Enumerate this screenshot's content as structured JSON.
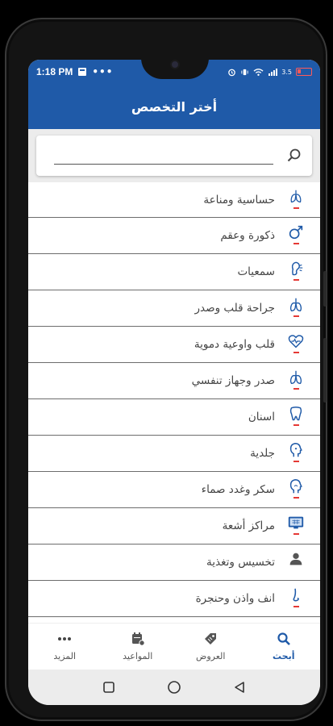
{
  "status_bar": {
    "time": "1:18 PM",
    "dots": "•••",
    "net_speed": "3.5"
  },
  "app_bar": {
    "title": "أختر التخصص"
  },
  "search": {
    "value": "",
    "placeholder": ""
  },
  "specialties": [
    {
      "label": "حساسية ومناعة",
      "icon": "lungs-outline-icon"
    },
    {
      "label": "ذكورة وعقم",
      "icon": "male-symbol-icon"
    },
    {
      "label": "سمعيات",
      "icon": "ear-icon"
    },
    {
      "label": "جراحة قلب وصدر",
      "icon": "lungs-icon"
    },
    {
      "label": "قلب واوعية دموية",
      "icon": "heart-pulse-icon"
    },
    {
      "label": "صدر وجهاز تنفسي",
      "icon": "lungs-icon"
    },
    {
      "label": "اسنان",
      "icon": "tooth-icon"
    },
    {
      "label": "جلدية",
      "icon": "head-profile-icon"
    },
    {
      "label": "سكر وغدد صماء",
      "icon": "head-profile-icon"
    },
    {
      "label": "مراكز أشعة",
      "icon": "monitor-icon"
    },
    {
      "label": "تخسيس وتغذية",
      "icon": "person-icon"
    },
    {
      "label": "انف واذن وحنجرة",
      "icon": "nose-icon"
    }
  ],
  "bottom_nav": [
    {
      "label": "أبحث",
      "icon": "search-icon",
      "active": true
    },
    {
      "label": "العروض",
      "icon": "tag-icon",
      "active": false
    },
    {
      "label": "المواعيد",
      "icon": "calendar-icon",
      "active": false
    },
    {
      "label": "المزيد",
      "icon": "more-dots-icon",
      "active": false
    }
  ],
  "colors": {
    "primary": "#1f5aa8",
    "accent_mark": "#e53935",
    "divider": "#6d6d6d"
  }
}
